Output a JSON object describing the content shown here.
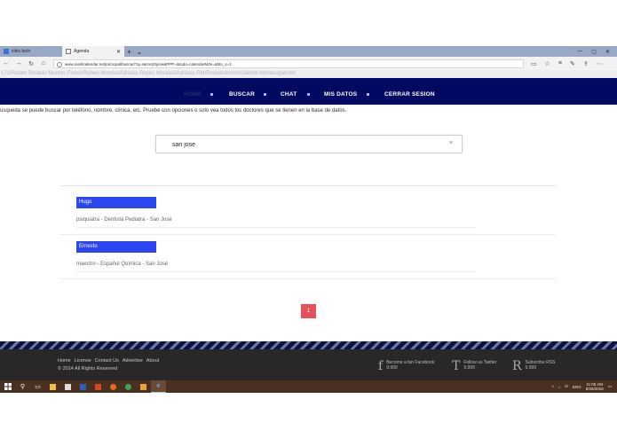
{
  "browser": {
    "tabs": [
      {
        "label": "citec.tech",
        "active": false
      },
      {
        "label": "Agenda",
        "active": true
      }
    ],
    "new_tab": "+",
    "tab_dropdown": "⌄",
    "address": "www.medicalendar.net/principal/buscar/?q=san%20jose&PPP=&todo=calendarMdv=&btn_s=1",
    "window_controls": [
      "—",
      "▢",
      "✕"
    ]
  },
  "breadcrumb": "171/Rubén Ricardo Montes Flores/Rubén Montes/Adriana Reyes Morales/Adriana RM/Ernesto/ernes/Gabriel Montes/gabriel/",
  "nav": {
    "items": [
      {
        "label": "HOME",
        "active": true
      },
      {
        "label": "BUSCAR",
        "active": false
      },
      {
        "label": "CHAT",
        "active": false
      },
      {
        "label": "MIS DATOS",
        "active": false
      },
      {
        "label": "CERRAR SESION",
        "active": false
      }
    ],
    "active_color": "#2a2f6a",
    "bg_color": "#020960"
  },
  "intro_text": "úsqueda se puede buscar por teléfono, nombre, clínica, etc. Pruebe con opciones o solo vea todos los doctores que se tienen en la base de datos.",
  "search": {
    "value": "san jose",
    "clear_label": "×"
  },
  "results": [
    {
      "name": "Hugo",
      "desc": "psiquiatra - Dentista Pediatra - San José"
    },
    {
      "name": "Ernesto",
      "desc": "maestro - Español Química - San José"
    }
  ],
  "result_bar_color": "#2c47f2",
  "pagination": {
    "current": "1",
    "color": "#e8505b"
  },
  "footer": {
    "links": [
      "Home",
      "License",
      "Contact Us",
      "Advertise",
      "About"
    ],
    "copyright": "© 2014 All Rights Reserved",
    "social": [
      {
        "glyph": "f",
        "title": "Become a fan Facebook",
        "count": "9,999"
      },
      {
        "glyph": "T",
        "title": "Follow us Twitter",
        "count": "9,999"
      },
      {
        "glyph": "R",
        "title": "Subscribe RSS",
        "count": "9,999"
      }
    ]
  },
  "taskbar": {
    "language": "ENG",
    "time": "11:05 AM",
    "date": "6/26/2016"
  }
}
